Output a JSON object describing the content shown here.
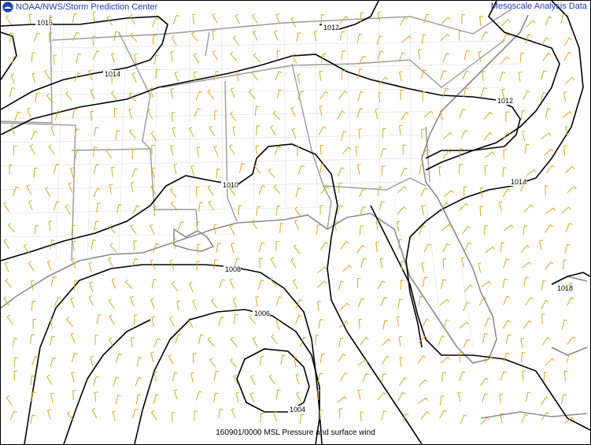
{
  "header": {
    "left_title": "NOAA/NWS/Storm Prediction Center",
    "right_title": "Mesoscale Analysis Data",
    "logo_icon": "noaa-logo-icon"
  },
  "footer": {
    "caption": "160901/0000 MSL Pressure and surface wind"
  },
  "map": {
    "isobar_color": "#000000",
    "state_border_color": "#9a9a9a",
    "county_border_color": "#d8d8d8",
    "wind_barb_color": "#d9a520",
    "isobar_labels": [
      "1016",
      "1012",
      "1014",
      "1012",
      "1010",
      "1014",
      "1008",
      "1006",
      "1018",
      "1004"
    ]
  }
}
